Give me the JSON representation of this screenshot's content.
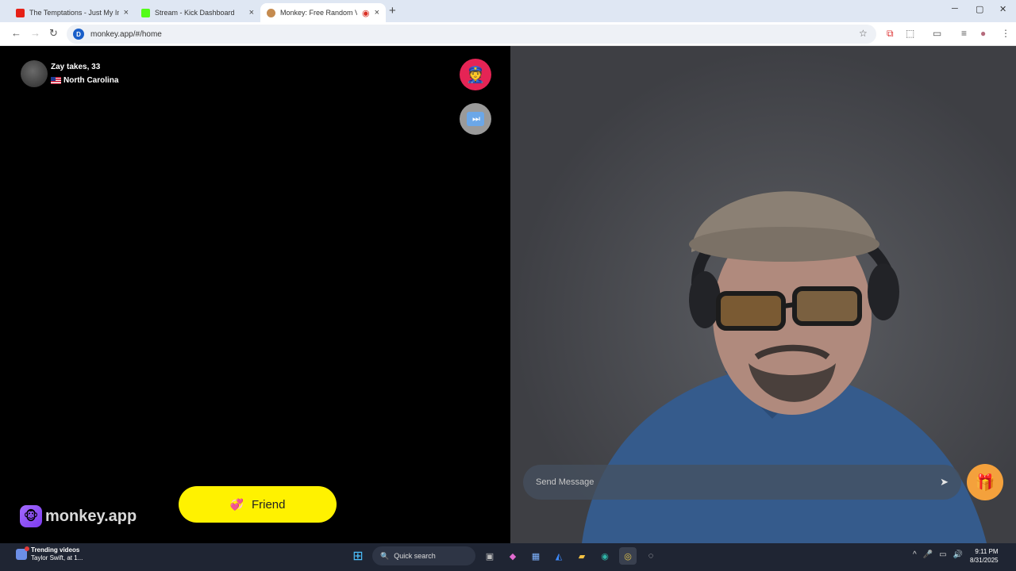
{
  "browser": {
    "tabs": [
      {
        "title": "The Temptations - Just My Imag",
        "color": "#e62117"
      },
      {
        "title": "Stream - Kick Dashboard",
        "color": "#53fc18"
      },
      {
        "title": "Monkey: Free Random Vide",
        "color": "#c58b4f"
      }
    ],
    "url": "monkey.app/#/home",
    "icons": {
      "back": "←",
      "forward": "→",
      "reload": "↻",
      "site": "D",
      "close_tab": "×",
      "new_tab": "+",
      "recording": "◉",
      "minimize": "─",
      "maximize": "▢",
      "close_window": "✕",
      "bookmark": "☆",
      "extension": "⧉",
      "puzzle": "⬚",
      "cast": "▭",
      "media": "≡",
      "profile": "●",
      "menu": "⋮"
    }
  },
  "left_panel": {
    "user_name": "Zay takes, 33",
    "user_location": "North Carolina",
    "report_icon": "👮",
    "skip_icon": "⏭",
    "logo_icon": "🐵",
    "logo_text": "monkey.app",
    "friend_icon": "💞",
    "friend_label": "Friend"
  },
  "right_panel": {
    "message_placeholder": "Send Message",
    "send_icon": "➤",
    "gift_icon": "🎁"
  },
  "taskbar": {
    "news_title": "Trending videos",
    "news_subtitle": "Taylor Swift, at 1...",
    "search_label": "Quick search",
    "search_icon": "🔍",
    "app_icons": {
      "start": "⊞",
      "task_view": "▣",
      "copilot": "◆",
      "store": "▦",
      "photos": "◭",
      "explorer": "▰",
      "edge": "◉",
      "chrome": "◎",
      "obs": "◌"
    },
    "tray_icons": {
      "chevron": "^",
      "mic": "🎤",
      "network": "▭",
      "volume": "🔊"
    },
    "time": "9:11 PM",
    "date": "8/31/2025"
  }
}
